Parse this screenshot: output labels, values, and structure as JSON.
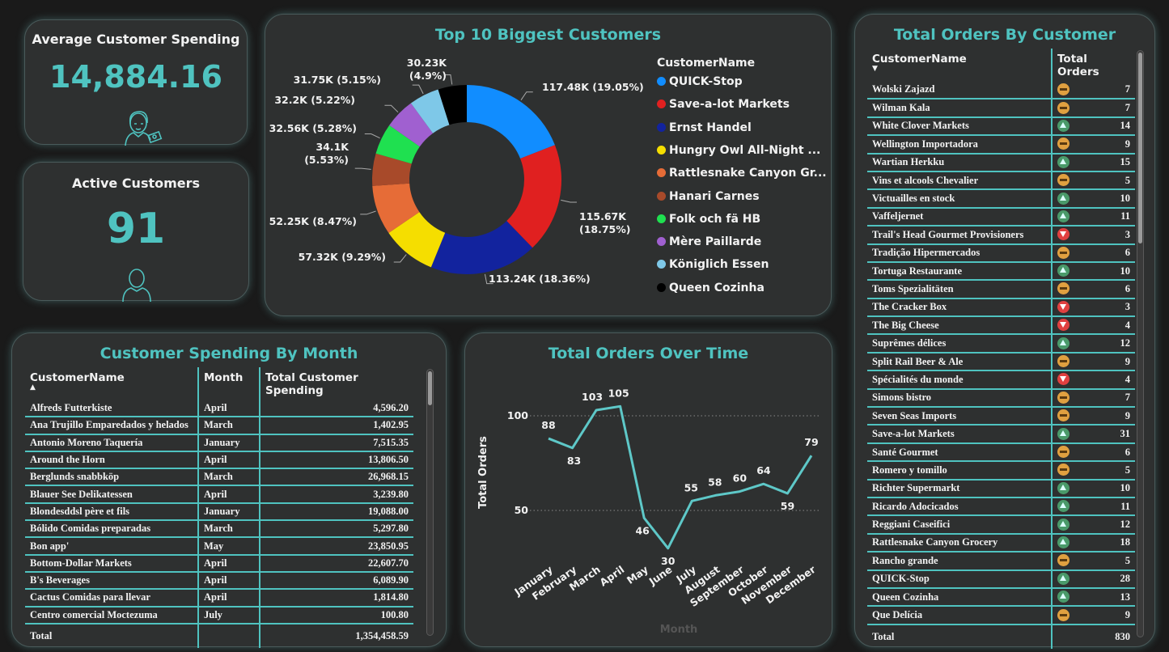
{
  "kpi_spending": {
    "label": "Average Customer Spending",
    "value": "14,884.16"
  },
  "kpi_active": {
    "label": "Active Customers",
    "value": "91"
  },
  "donut": {
    "title": "Top 10 Biggest Customers",
    "legend_title": "CustomerName",
    "legend": [
      "QUICK-Stop",
      "Save-a-lot Markets",
      "Ernst Handel",
      "Hungry Owl All-Night ...",
      "Rattlesnake Canyon Gr...",
      "Hanari Carnes",
      "Folk och fä HB",
      "Mère Paillarde",
      "Königlich Essen",
      "Queen Cozinha"
    ]
  },
  "spending_table": {
    "title": "Customer Spending By Month",
    "headers": [
      "CustomerName",
      "Month",
      "Total Customer Spending"
    ],
    "rows": [
      [
        "Alfreds Futterkiste",
        "April",
        "4,596.20"
      ],
      [
        "Ana Trujillo Emparedados y helados",
        "March",
        "1,402.95"
      ],
      [
        "Antonio Moreno Taquería",
        "January",
        "7,515.35"
      ],
      [
        "Around the Horn",
        "April",
        "13,806.50"
      ],
      [
        "Berglunds snabbköp",
        "March",
        "26,968.15"
      ],
      [
        "Blauer See Delikatessen",
        "April",
        "3,239.80"
      ],
      [
        "Blondesddsl père et fils",
        "January",
        "19,088.00"
      ],
      [
        "Bólido Comidas preparadas",
        "March",
        "5,297.80"
      ],
      [
        "Bon app'",
        "May",
        "23,850.95"
      ],
      [
        "Bottom-Dollar Markets",
        "April",
        "22,607.70"
      ],
      [
        "B's Beverages",
        "April",
        "6,089.90"
      ],
      [
        "Cactus Comidas para llevar",
        "April",
        "1,814.80"
      ],
      [
        "Centro comercial Moctezuma",
        "July",
        "100.80"
      ]
    ],
    "total_label": "Total",
    "total_value": "1,354,458.59"
  },
  "orders_table": {
    "title": "Total Orders By Customer",
    "headers": [
      "CustomerName",
      "Total Orders"
    ],
    "rows": [
      [
        "Wolski Zajazd",
        "mid",
        "7"
      ],
      [
        "Wilman Kala",
        "mid",
        "7"
      ],
      [
        "White Clover Markets",
        "up",
        "14"
      ],
      [
        "Wellington Importadora",
        "mid",
        "9"
      ],
      [
        "Wartian Herkku",
        "up",
        "15"
      ],
      [
        "Vins et alcools Chevalier",
        "mid",
        "5"
      ],
      [
        "Victuailles en stock",
        "up",
        "10"
      ],
      [
        "Vaffeljernet",
        "up",
        "11"
      ],
      [
        "Trail's Head Gourmet Provisioners",
        "down",
        "3"
      ],
      [
        "Tradição Hipermercados",
        "mid",
        "6"
      ],
      [
        "Tortuga Restaurante",
        "up",
        "10"
      ],
      [
        "Toms Spezialitäten",
        "mid",
        "6"
      ],
      [
        "The Cracker Box",
        "down",
        "3"
      ],
      [
        "The Big Cheese",
        "down",
        "4"
      ],
      [
        "Suprêmes délices",
        "up",
        "12"
      ],
      [
        "Split Rail Beer & Ale",
        "mid",
        "9"
      ],
      [
        "Spécialités du monde",
        "down",
        "4"
      ],
      [
        "Simons bistro",
        "mid",
        "7"
      ],
      [
        "Seven Seas Imports",
        "mid",
        "9"
      ],
      [
        "Save-a-lot Markets",
        "up",
        "31"
      ],
      [
        "Santé Gourmet",
        "mid",
        "6"
      ],
      [
        "Romero y tomillo",
        "mid",
        "5"
      ],
      [
        "Richter Supermarkt",
        "up",
        "10"
      ],
      [
        "Ricardo Adocicados",
        "up",
        "11"
      ],
      [
        "Reggiani Caseifici",
        "up",
        "12"
      ],
      [
        "Rattlesnake Canyon Grocery",
        "up",
        "18"
      ],
      [
        "Rancho grande",
        "mid",
        "5"
      ],
      [
        "QUICK-Stop",
        "up",
        "28"
      ],
      [
        "Queen Cozinha",
        "up",
        "13"
      ],
      [
        "Que Delícia",
        "mid",
        "9"
      ]
    ],
    "total_label": "Total",
    "total_value": "830"
  },
  "line": {
    "title": "Total Orders Over Time"
  },
  "chart_data": [
    {
      "type": "pie",
      "title": "Top 10 Biggest Customers",
      "categories": [
        "QUICK-Stop",
        "Save-a-lot Markets",
        "Ernst Handel",
        "Hungry Owl All-Night ...",
        "Rattlesnake Canyon Gr...",
        "Hanari Carnes",
        "Folk och fä HB",
        "Mère Paillarde",
        "Königlich Essen",
        "Queen Cozinha"
      ],
      "values": [
        117.48,
        115.67,
        113.24,
        57.32,
        52.25,
        34.1,
        32.56,
        32.2,
        31.75,
        30.23
      ],
      "labels": [
        "117.48K (19.05%)",
        "115.67K (18.75%)",
        "113.24K (18.36%)",
        "57.32K (9.29%)",
        "52.25K (8.47%)",
        "34.1K (5.53%)",
        "32.56K (5.28%)",
        "32.2K (5.22%)",
        "31.75K (5.15%)",
        "30.23K (4.9%)"
      ],
      "colors": [
        "#118dff",
        "#e02020",
        "#12239e",
        "#f5de00",
        "#e66c37",
        "#a84a2a",
        "#1fe050",
        "#a060d0",
        "#7ec8e8",
        "#000000"
      ],
      "donut": true
    },
    {
      "type": "line",
      "title": "Total Orders Over Time",
      "xlabel": "Month",
      "ylabel": "Total Orders",
      "x": [
        "January",
        "February",
        "March",
        "April",
        "May",
        "June",
        "July",
        "August",
        "September",
        "October",
        "November",
        "December"
      ],
      "values": [
        88,
        83,
        103,
        105,
        46,
        30,
        55,
        58,
        60,
        64,
        59,
        79
      ],
      "yticks": [
        50,
        100
      ],
      "color": "#5ec8c8",
      "grid": "dotted"
    }
  ]
}
